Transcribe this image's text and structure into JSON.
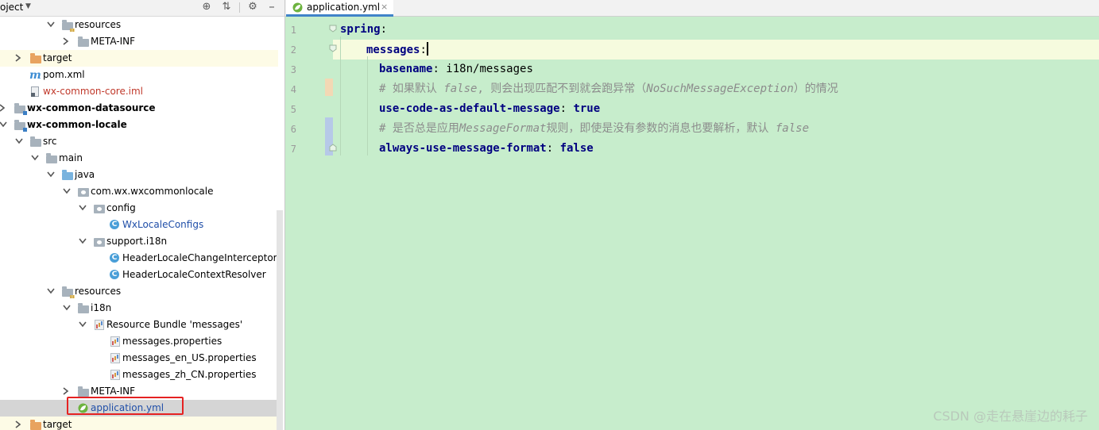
{
  "project_panel": {
    "title": "oject",
    "tree": [
      {
        "label": "resources"
      },
      {
        "label": "META-INF"
      },
      {
        "label": "target"
      },
      {
        "label": "pom.xml"
      },
      {
        "label": "wx-common-core.iml"
      },
      {
        "label": "wx-common-datasource"
      },
      {
        "label": "wx-common-locale"
      },
      {
        "label": "src"
      },
      {
        "label": "main"
      },
      {
        "label": "java"
      },
      {
        "label": "com.wx.wxcommonlocale"
      },
      {
        "label": "config"
      },
      {
        "label": "WxLocaleConfigs"
      },
      {
        "label": "support.i18n"
      },
      {
        "label": "HeaderLocaleChangeInterceptor"
      },
      {
        "label": "HeaderLocaleContextResolver"
      },
      {
        "label": "resources"
      },
      {
        "label": "i18n"
      },
      {
        "label": "Resource Bundle 'messages'"
      },
      {
        "label": "messages.properties"
      },
      {
        "label": "messages_en_US.properties"
      },
      {
        "label": "messages_zh_CN.properties"
      },
      {
        "label": "META-INF"
      },
      {
        "label": "application.yml"
      },
      {
        "label": "target"
      }
    ],
    "icons": [
      "globe-icon",
      "collapse-icon",
      "gear-icon",
      "hide-icon"
    ]
  },
  "editor": {
    "tab": {
      "label": "application.yml",
      "close": "×"
    },
    "line_numbers": [
      "1",
      "2",
      "3",
      "4",
      "5",
      "6",
      "7"
    ],
    "lines": [
      {
        "key": "spring",
        "sep": ":"
      },
      {
        "key": "messages",
        "sep": ":"
      },
      {
        "key": "basename",
        "sep": ": ",
        "value": "i18n/messages"
      },
      {
        "comment_parts": [
          "# 如果默认 ",
          "false",
          ", 则会出现匹配不到就会跑异常（",
          "NoSuchMessageException",
          "）的情况"
        ]
      },
      {
        "key": "use-code-as-default-message",
        "sep": ": ",
        "value": "true"
      },
      {
        "comment_parts": [
          "# 是否总是应用",
          "MessageFormat",
          "规则，即使是没有参数的消息也要解析，默认 ",
          "false"
        ]
      },
      {
        "key": "always-use-message-format",
        "sep": ": ",
        "value": "false"
      }
    ]
  },
  "watermark": "CSDN @走在悬崖边的耗子",
  "colors": {
    "editor_bg": "#c7edcc",
    "current_line": "#f6fbde",
    "yaml_key": "#000080",
    "comment": "#8c8c8c",
    "highlight_box": "#e52222",
    "tab_underline": "#4083c9"
  }
}
